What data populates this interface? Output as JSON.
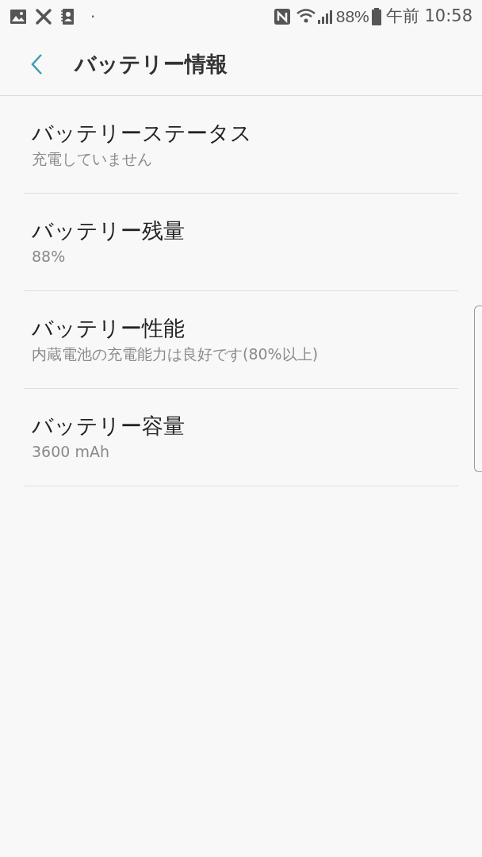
{
  "status_bar": {
    "dot": "·",
    "battery": "88%",
    "time": "午前 10:58"
  },
  "header": {
    "title": "バッテリー情報"
  },
  "items": [
    {
      "title": "バッテリーステータス",
      "subtitle": "充電していません"
    },
    {
      "title": "バッテリー残量",
      "subtitle": "88%"
    },
    {
      "title": "バッテリー性能",
      "subtitle": "内蔵電池の充電能力は良好です(80%以上)"
    },
    {
      "title": "バッテリー容量",
      "subtitle": "3600 mAh"
    }
  ]
}
